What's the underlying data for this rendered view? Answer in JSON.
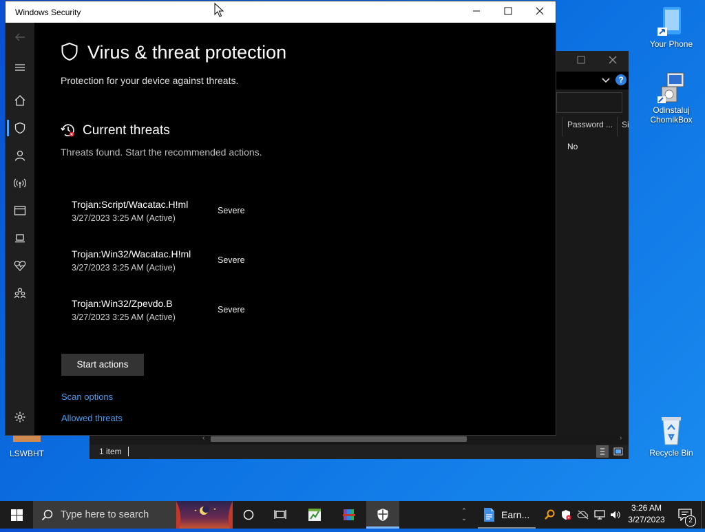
{
  "desktop": {
    "icons": [
      {
        "label": "Your Phone"
      },
      {
        "label": "Odinstaluj ChomikBox"
      },
      {
        "label": "LSWBHT"
      },
      {
        "label": "Recycle Bin"
      }
    ]
  },
  "bg_window": {
    "column_password": "Password ...",
    "column_size_partial": "Si",
    "cell_password_value": "No",
    "status_item_count": "1 item"
  },
  "security_window": {
    "title": "Windows Security",
    "page_title": "Virus & threat protection",
    "page_subtitle": "Protection for your device against threats.",
    "section_title": "Current threats",
    "section_subtitle": "Threats found. Start the recommended actions.",
    "threats": [
      {
        "name": "Trojan:Script/Wacatac.H!ml",
        "detail": "3/27/2023 3:25 AM (Active)",
        "severity": "Severe"
      },
      {
        "name": "Trojan:Win32/Wacatac.H!ml",
        "detail": "3/27/2023 3:25 AM (Active)",
        "severity": "Severe"
      },
      {
        "name": "Trojan:Win32/Zpevdo.B",
        "detail": "3/27/2023 3:25 AM (Active)",
        "severity": "Severe"
      }
    ],
    "start_actions_label": "Start actions",
    "links": {
      "scan_options": "Scan options",
      "allowed_threats": "Allowed threats"
    },
    "nav_icons": [
      "back-icon",
      "menu-icon",
      "home-icon",
      "shield-icon",
      "account-icon",
      "wifi-icon",
      "app-browser-icon",
      "device-icon",
      "health-icon",
      "family-icon",
      "settings-icon"
    ]
  },
  "taskbar": {
    "search_placeholder": "Type here to search",
    "earn_label": "Earn...",
    "time": "3:26 AM",
    "date": "3/27/2023",
    "notification_count": "2"
  },
  "colors": {
    "accent_link": "#4a9cf0",
    "desktop_blue": "#0b6ee0",
    "window_bg": "#000000"
  }
}
